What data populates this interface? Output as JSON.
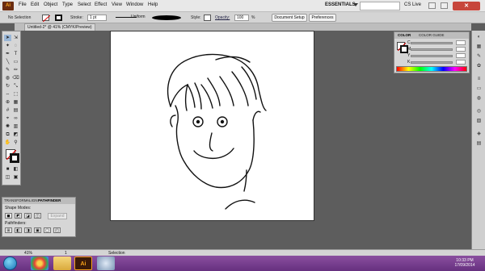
{
  "app": {
    "icon_text": "Ai"
  },
  "menu": [
    "File",
    "Edit",
    "Object",
    "Type",
    "Select",
    "Effect",
    "View",
    "Window",
    "Help"
  ],
  "workspace": {
    "label": "ESSENTIALS",
    "search_placeholder": "",
    "cs_live": "CS Live"
  },
  "control_bar": {
    "selection": "No Selection",
    "stroke_label": "Stroke:",
    "stroke_weight": "1 pt",
    "profile": "Uniform",
    "style_label": "Style:",
    "opacity_label": "Opacity:",
    "opacity_value": "100",
    "percent": "%",
    "doc_setup": "Document Setup",
    "preferences": "Preferences"
  },
  "document": {
    "tab_title": "Untitled-2* @ 41% (CMYK/Preview)"
  },
  "color_panel": {
    "tab_color": "COLOR",
    "tab_guide": "COLOR GUIDE",
    "labels": [
      "C",
      "M",
      "Y",
      "K"
    ]
  },
  "pathfinder": {
    "tab_transform": "TRANSFORM",
    "tab_align": "ALIGN",
    "tab_pathfinder": "PATHFINDER",
    "shape_modes": "Shape Modes:",
    "expand": "Expand",
    "pathfinders": "Pathfinders:"
  },
  "status_bar": {
    "zoom": "41%",
    "page": "1",
    "tool": "Selection"
  },
  "taskbar": {
    "time": "10:33 PM",
    "date": "17/09/2014"
  },
  "colors": {
    "taskbar": "#66307f",
    "close_button": "#c7463b",
    "menu_bg": "#e8e8e8"
  }
}
